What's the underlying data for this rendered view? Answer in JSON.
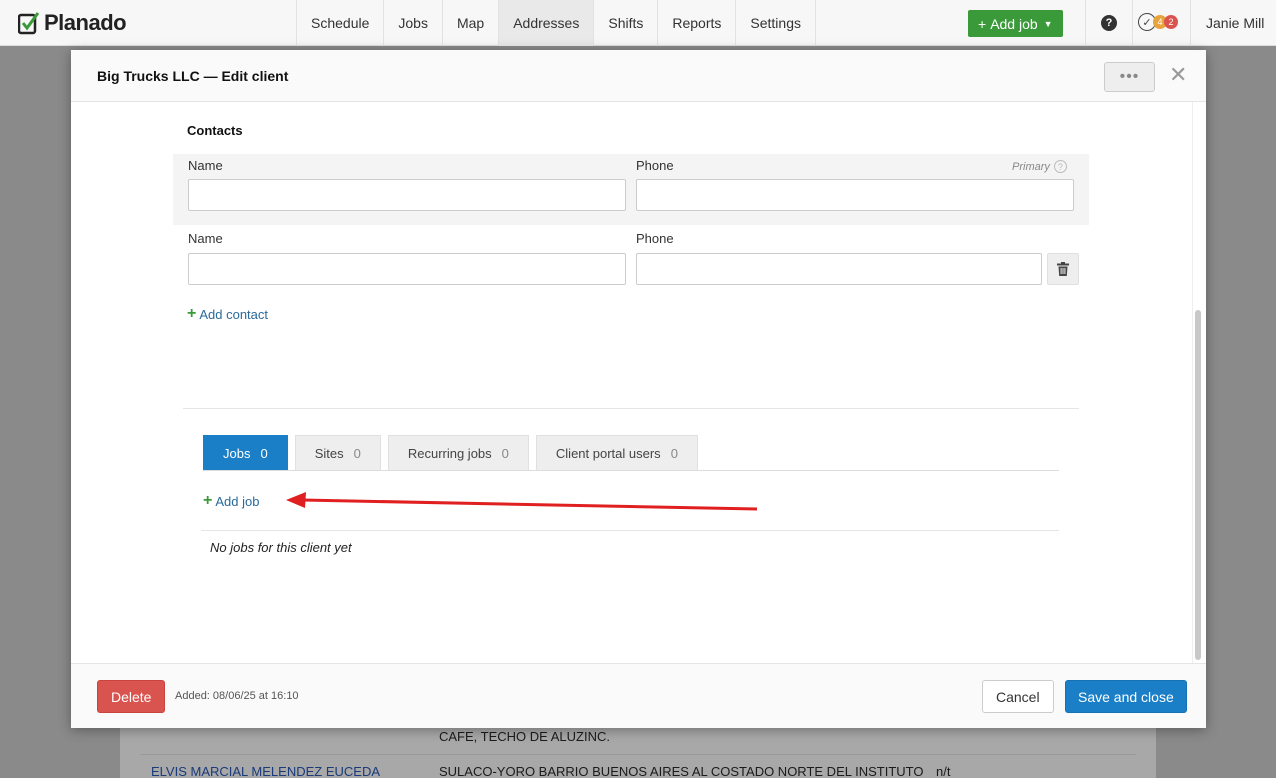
{
  "app": {
    "logo_text": "Planado",
    "nav": [
      "Schedule",
      "Jobs",
      "Map",
      "Addresses",
      "Shifts",
      "Reports",
      "Settings"
    ],
    "active_nav": "Addresses",
    "add_job_label": "Add job",
    "help_label": "?",
    "notif_orange": "4",
    "notif_red": "2",
    "user_name": "Janie Mill"
  },
  "modal": {
    "title": "Big Trucks LLC — Edit client",
    "more_label": "•••",
    "close_label": "✕",
    "contacts": {
      "section_title": "Contacts",
      "primary_label": "Primary",
      "primary_help": "?",
      "rows": [
        {
          "name_label": "Name",
          "phone_label": "Phone",
          "name_value": "",
          "phone_value": ""
        },
        {
          "name_label": "Name",
          "phone_label": "Phone",
          "name_value": "",
          "phone_value": ""
        }
      ],
      "add_contact_label": "Add contact"
    },
    "tabs": [
      {
        "label": "Jobs",
        "count": "0",
        "active": true
      },
      {
        "label": "Sites",
        "count": "0",
        "active": false
      },
      {
        "label": "Recurring jobs",
        "count": "0",
        "active": false
      },
      {
        "label": "Client portal users",
        "count": "0",
        "active": false
      }
    ],
    "add_job_link": "Add job",
    "empty_jobs_text": "No jobs for this client yet",
    "footer": {
      "delete_label": "Delete",
      "added_text": "Added: 08/06/25 at 16:10",
      "cancel_label": "Cancel",
      "save_label": "Save and close"
    }
  },
  "background_rows": {
    "row1_address": "CAFE, TECHO DE ALUZINC.",
    "row2_name": "ELVIS MARCIAL MELENDEZ EUCEDA",
    "row2_address": "SULACO-YORO BARRIO BUENOS AIRES AL COSTADO NORTE DEL INSTITUTO",
    "row2_extra": "n/t"
  },
  "colors": {
    "primary": "#1a7fc6",
    "success": "#3a9a3a",
    "danger": "#d9534f",
    "annotation_arrow": "#e02020"
  }
}
